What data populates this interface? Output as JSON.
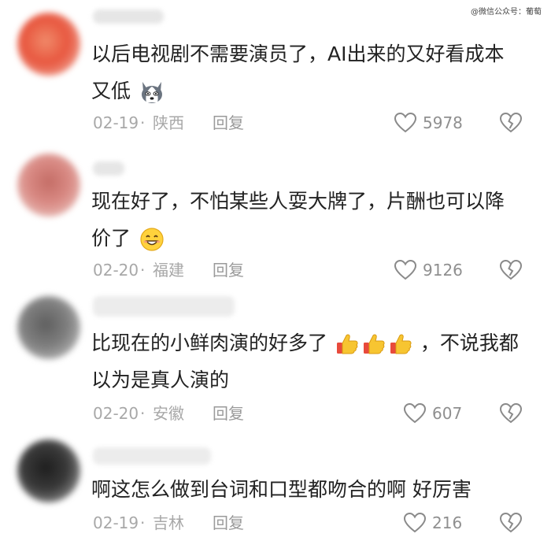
{
  "watermark": "@微信公众号：葡萄",
  "comments": [
    {
      "lines": [
        "以后电视剧不需要演员了，AI出来的又好看成本",
        "又低"
      ],
      "emoji": "husky-dog-emoji",
      "date": "02-19",
      "location": "陕西",
      "reply_label": "回复",
      "likes": "5978"
    },
    {
      "lines": [
        "现在好了，不怕某些人耍大牌了，片酬也可以降",
        "价了"
      ],
      "emoji": "smiling-face-emoji",
      "date": "02-20",
      "location": "福建",
      "reply_label": "回复",
      "likes": "9126"
    },
    {
      "lines": [
        "比现在的小鲜肉演的好多了",
        "，不说我都",
        "以为是真人演的"
      ],
      "emoji": "thumbs-up-emoji",
      "date": "02-20",
      "location": "安徽",
      "reply_label": "回复",
      "likes": "607"
    },
    {
      "lines": [
        "啊这怎么做到台词和口型都吻合的啊 好厉害"
      ],
      "date": "02-19",
      "location": "吉林",
      "reply_label": "回复",
      "likes": "216"
    }
  ],
  "separator": "·",
  "colors": {
    "text": "#222222",
    "meta": "#a8a8a8",
    "avatar_1": "#e8573f",
    "avatar_2": "#d98a84",
    "avatar_3": "#7f7f7f",
    "avatar_4": "#3a3a3a"
  }
}
